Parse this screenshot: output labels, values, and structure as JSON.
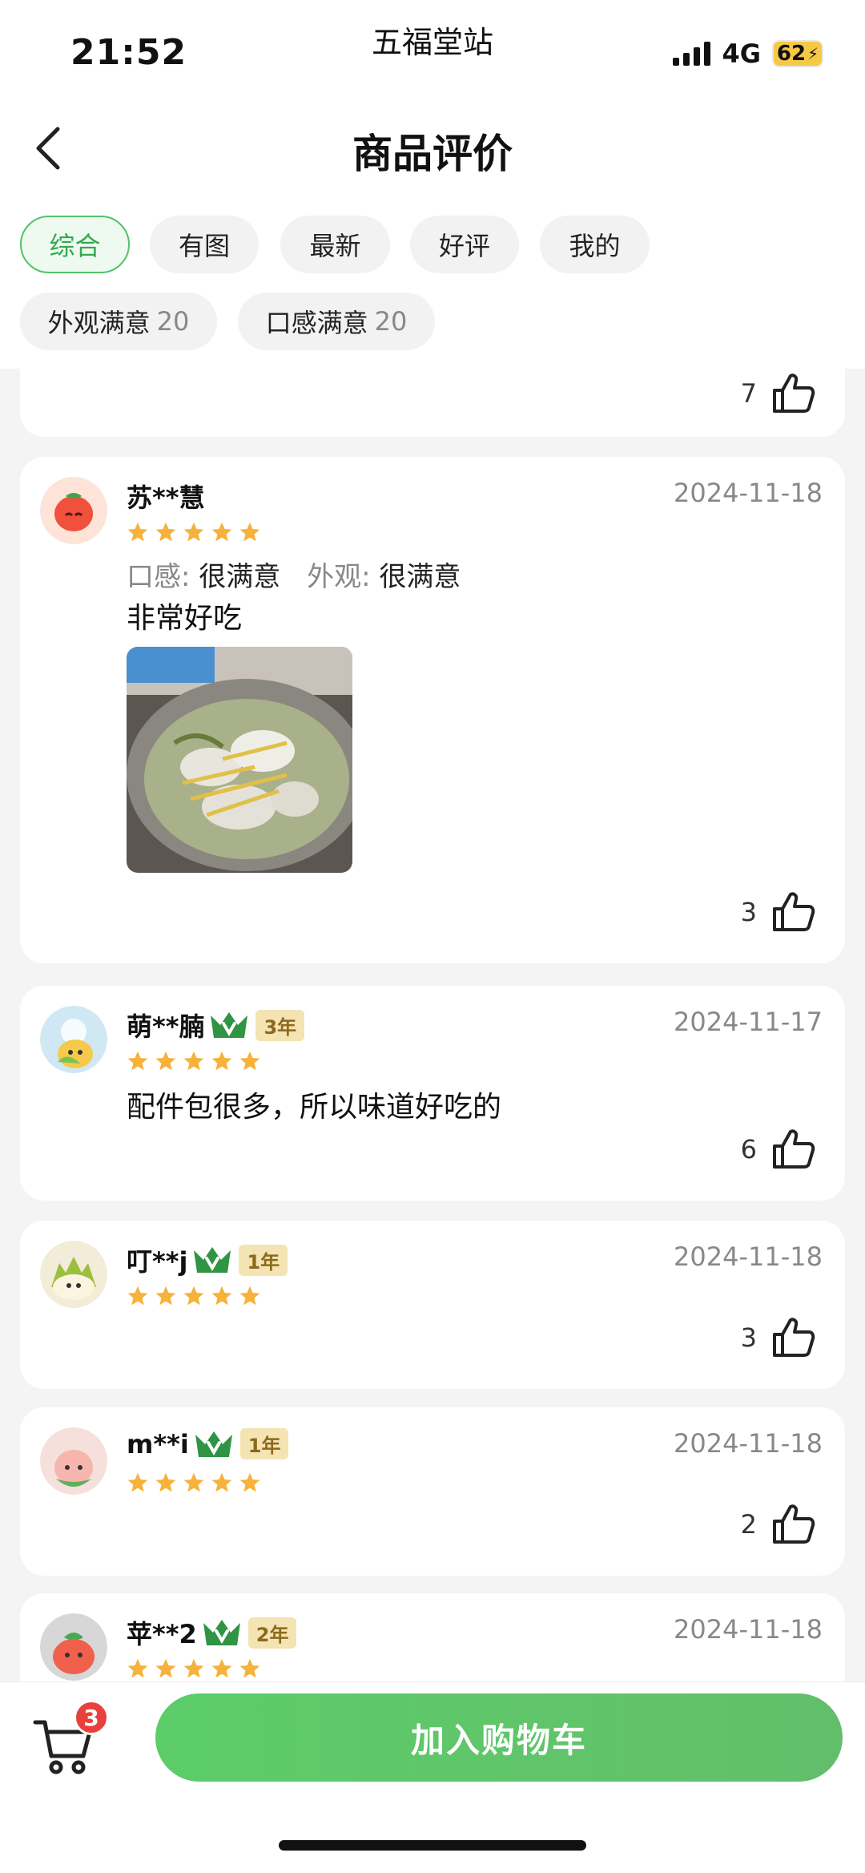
{
  "status_bar": {
    "time": "21:52",
    "location": "五福堂站",
    "network": "4G",
    "battery": "62"
  },
  "header": {
    "title": "商品评价"
  },
  "filters": [
    {
      "label": "综合",
      "active": true
    },
    {
      "label": "有图"
    },
    {
      "label": "最新"
    },
    {
      "label": "好评"
    },
    {
      "label": "我的"
    }
  ],
  "tags": [
    {
      "label": "外观满意",
      "count": "20"
    },
    {
      "label": "口感满意",
      "count": "20"
    }
  ],
  "reviews": [
    {
      "partial": true,
      "likes": "7"
    },
    {
      "user": "苏**慧",
      "date": "2024-11-18",
      "rating": 5,
      "attr1_label": "口感:",
      "attr1_value": "很满意",
      "attr2_label": "外观:",
      "attr2_value": "很满意",
      "text": "非常好吃",
      "likes": "3"
    },
    {
      "user": "萌**腩",
      "tenure": "3年",
      "date": "2024-11-17",
      "rating": 5,
      "text": "配件包很多，所以味道好吃的",
      "likes": "6"
    },
    {
      "user": "叮**j",
      "tenure": "1年",
      "date": "2024-11-18",
      "rating": 5,
      "likes": "3"
    },
    {
      "user": "m**i",
      "tenure": "1年",
      "date": "2024-11-18",
      "rating": 5,
      "likes": "2"
    },
    {
      "user": "苹**2",
      "tenure": "2年",
      "date": "2024-11-18",
      "rating": 5
    }
  ],
  "bottom": {
    "cart_count": "3",
    "add_to_cart": "加入购物车"
  },
  "colors": {
    "accent": "#52c26b",
    "star": "#f6b23a",
    "badge": "#e8413d"
  }
}
